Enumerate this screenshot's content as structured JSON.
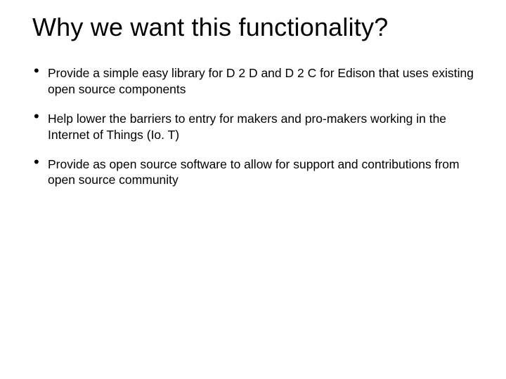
{
  "slide": {
    "title": "Why we want this functionality?",
    "bullets": [
      "Provide a simple easy library for D 2 D and D 2 C for Edison that uses existing open source components",
      "Help lower the barriers to entry for makers and pro-makers working in the Internet of Things (Io. T)",
      "Provide as open source software to allow for support and contributions from open source community"
    ]
  }
}
